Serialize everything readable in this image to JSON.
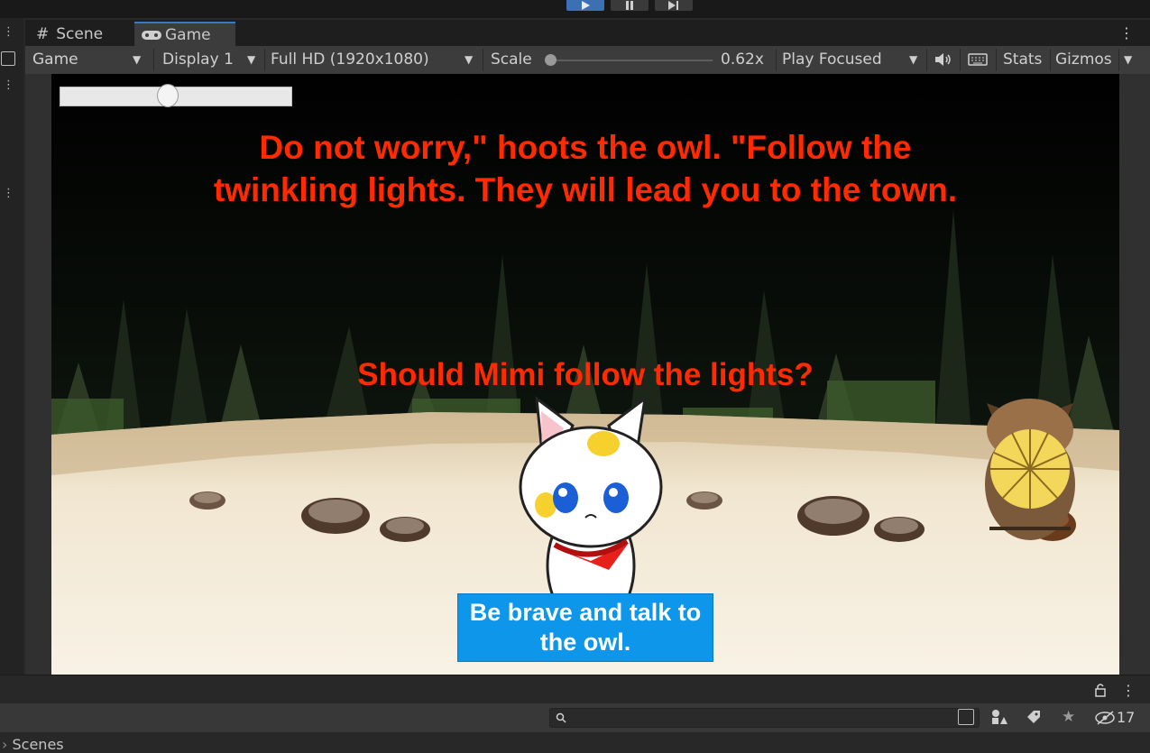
{
  "tabs": {
    "scene_label": "Scene",
    "game_label": "Game"
  },
  "toolbar": {
    "game_view": "Game",
    "display": "Display 1",
    "resolution": "Full HD (1920x1080)",
    "scale_label": "Scale",
    "scale_value": "0.62x",
    "play_mode": "Play Focused",
    "stats": "Stats",
    "gizmos": "Gizmos"
  },
  "game": {
    "dialogue": "Do not worry,\" hoots the owl. \"Follow the twinkling lights. They will lead you to the town.",
    "question": "Should Mimi follow the lights?",
    "choice_button": "Be brave and talk to the owl.",
    "slider_value": 0.46
  },
  "bottom": {
    "hidden_count": "17",
    "scenes_label": "Scenes"
  },
  "colors": {
    "editor_bg": "#282828",
    "accent": "#3b78c4",
    "game_text": "#ff2a00",
    "choice_bg": "#0e96ea"
  }
}
